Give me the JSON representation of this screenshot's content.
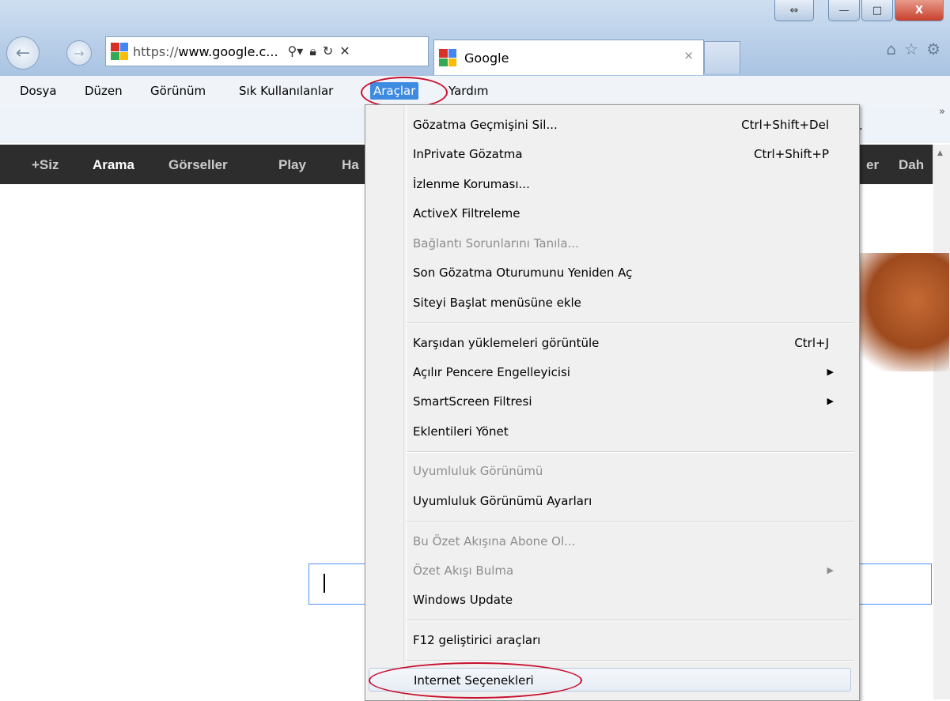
{
  "address_bar": {
    "url_prefix": "https://",
    "url_host": "www.google.c...",
    "search_icon": "search-icon",
    "lock_icon": "lock-icon",
    "refresh_icon": "refresh-icon",
    "stop_icon": "close-icon"
  },
  "tab": {
    "title": "Google",
    "close": "×"
  },
  "window_controls": {
    "restore": "⇔",
    "minimize": "—",
    "maximize": "□",
    "close": "X"
  },
  "toolbar_icons": [
    "home-icon",
    "star-icon",
    "gear-icon"
  ],
  "menu_bar": {
    "items": [
      "Dosya",
      "Düzen",
      "Görünüm",
      "Sık Kullanılanlar",
      "Araçlar",
      "Yardım"
    ],
    "active": "Araçlar",
    "overflow": "»",
    "partial_text": "."
  },
  "google_bar": {
    "items": [
      "+Siz",
      "Arama",
      "Görseller",
      "Play",
      "Ha"
    ],
    "right_items": [
      "er",
      "Dah"
    ]
  },
  "tools_menu": {
    "groups": [
      [
        {
          "label": "Gözatma Geçmişini Sil...",
          "shortcut": "Ctrl+Shift+Del"
        },
        {
          "label": "InPrivate Gözatma",
          "shortcut": "Ctrl+Shift+P"
        },
        {
          "label": "İzlenme Koruması..."
        },
        {
          "label": "ActiveX Filtreleme"
        },
        {
          "label": "Bağlantı Sorunlarını Tanıla...",
          "disabled": true
        },
        {
          "label": "Son Gözatma Oturumunu Yeniden Aç"
        },
        {
          "label": "Siteyi Başlat menüsüne ekle"
        }
      ],
      [
        {
          "label": "Karşıdan yüklemeleri görüntüle",
          "shortcut": "Ctrl+J"
        },
        {
          "label": "Açılır Pencere Engelleyicisi",
          "submenu": true
        },
        {
          "label": "SmartScreen Filtresi",
          "submenu": true
        },
        {
          "label": "Eklentileri Yönet"
        }
      ],
      [
        {
          "label": "Uyumluluk Görünümü",
          "disabled": true
        },
        {
          "label": "Uyumluluk Görünümü Ayarları"
        }
      ],
      [
        {
          "label": "Bu Özet Akışına Abone Ol...",
          "disabled": true
        },
        {
          "label": "Özet Akışı Bulma",
          "disabled": true,
          "submenu": true
        },
        {
          "label": "Windows Update"
        }
      ],
      [
        {
          "label": "F12 geliştirici araçları"
        }
      ],
      [
        {
          "label": "Internet Seçenekleri",
          "highlighted": true
        }
      ]
    ]
  },
  "colors": {
    "annotation": "#c8102e",
    "menu_active": "#3d8be0",
    "google_bar": "#2d2d2d"
  }
}
